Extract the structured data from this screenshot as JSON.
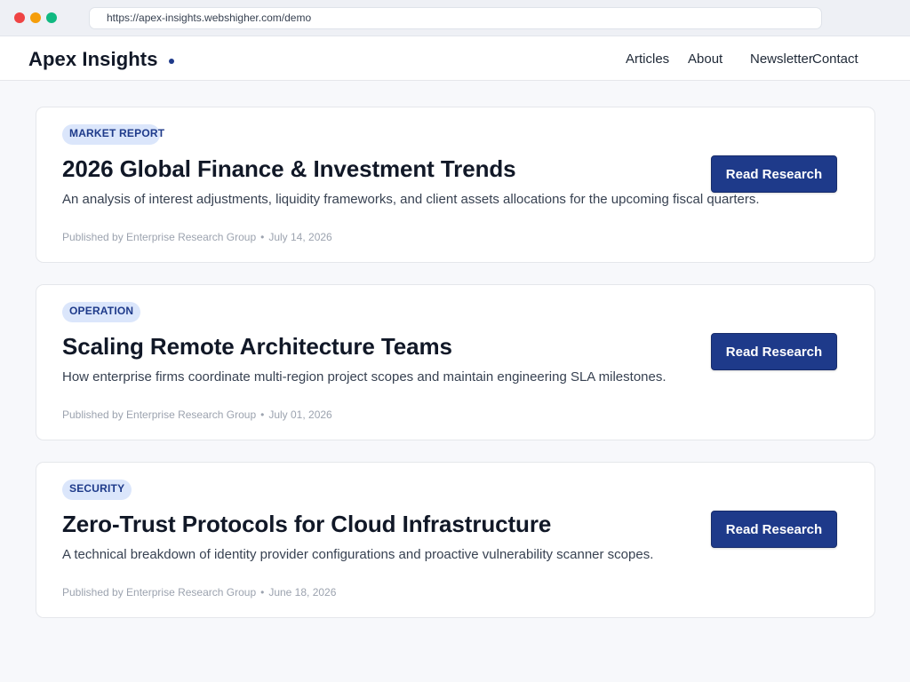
{
  "browser": {
    "url": "https://apex-insights.webshigher.com/demo"
  },
  "header": {
    "brand": "Apex Insights",
    "nav": [
      "Articles",
      "About",
      "Newsletter",
      "Contact"
    ]
  },
  "articles": [
    {
      "tag": "MARKET REPORT",
      "title": "2026 Global Finance & Investment Trends",
      "description": "An analysis of interest adjustments, liquidity frameworks, and client assets allocations for the upcoming fiscal quarters.",
      "publisher": "Published by Enterprise Research Group",
      "separator": "•",
      "date": "July 14, 2026",
      "button": "Read Research"
    },
    {
      "tag": "OPERATION",
      "title": "Scaling Remote Architecture Teams",
      "description": "How enterprise firms coordinate multi-region project scopes and maintain engineering SLA milestones.",
      "publisher": "Published by Enterprise Research Group",
      "separator": "•",
      "date": "July 01, 2026",
      "button": "Read Research"
    },
    {
      "tag": "SECURITY",
      "title": "Zero-Trust Protocols for Cloud Infrastructure",
      "description": "A technical breakdown of identity provider configurations and proactive vulnerability scanner scopes.",
      "publisher": "Published by Enterprise Research Group",
      "separator": "•",
      "date": "June 18, 2026",
      "button": "Read Research"
    }
  ],
  "colors": {
    "accent": "#1e3a8a",
    "tag_bg": "#dbe6fb",
    "close_dot": "#ef4444",
    "minimize_dot": "#f59e0b",
    "maximize_dot": "#10b981"
  }
}
